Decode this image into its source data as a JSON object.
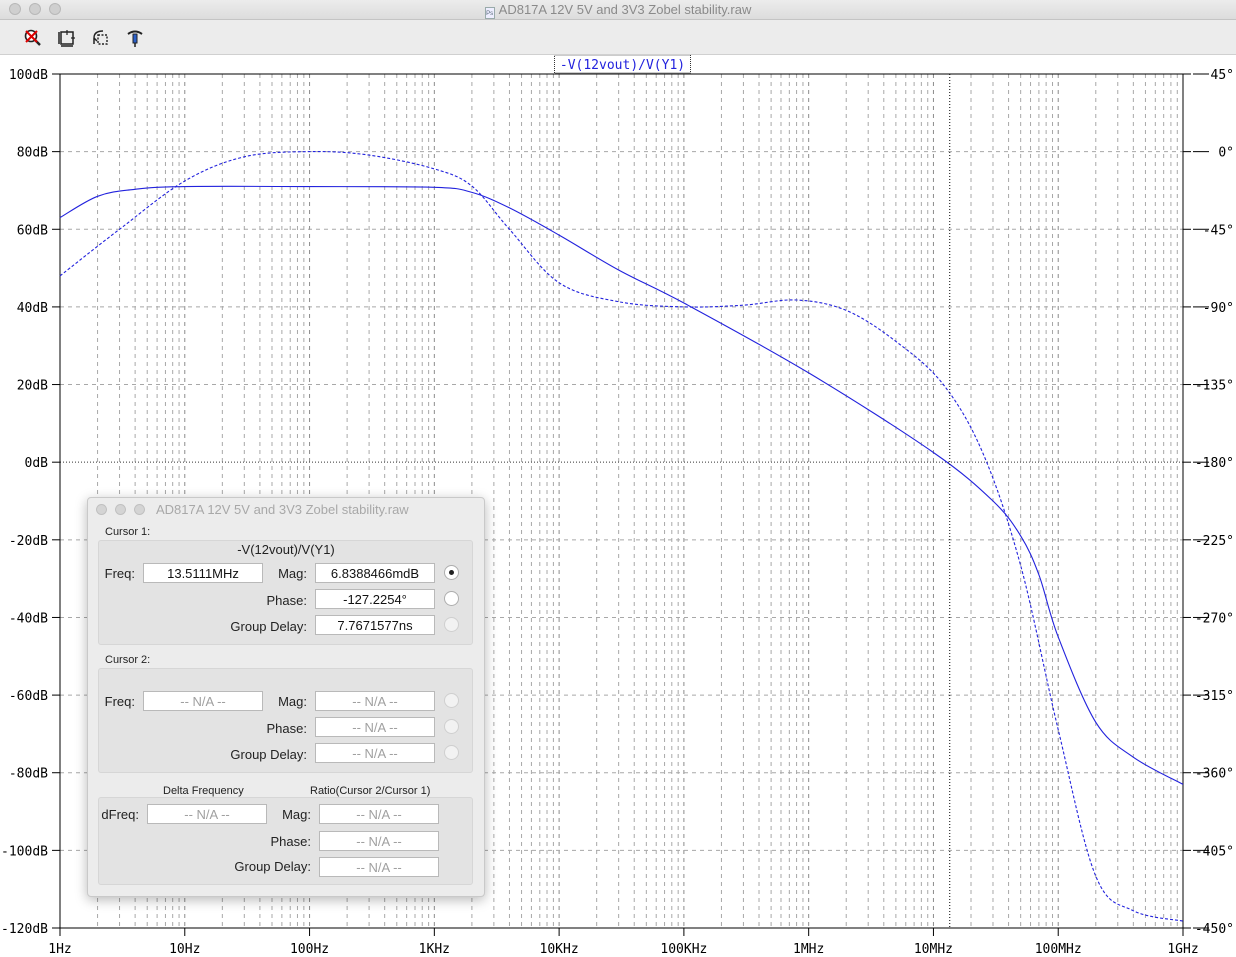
{
  "window": {
    "title": "AD817A 12V 5V and 3V3 Zobel stability.raw"
  },
  "toolbar": {
    "icons": [
      "zoom-cancel-icon",
      "autorange-icon",
      "undo-zoom-icon",
      "probe-icon"
    ]
  },
  "chart_data": {
    "type": "line",
    "trace_label": "-V(12vout)/V(Y1)",
    "x_scale": "log",
    "x_range_hz": [
      1,
      1000000000
    ],
    "x_tick_labels": [
      "1Hz",
      "10Hz",
      "100Hz",
      "1KHz",
      "10KHz",
      "100KHz",
      "1MHz",
      "10MHz",
      "100MHz",
      "1GHz"
    ],
    "y_left_range_db": [
      -120,
      100
    ],
    "y_left_tick_labels": [
      "100dB",
      "80dB",
      "60dB",
      "40dB",
      "20dB",
      "0dB",
      "-20dB",
      "-40dB",
      "-60dB",
      "-80dB",
      "-100dB",
      "-120dB"
    ],
    "y_right_range_deg": [
      -450,
      45
    ],
    "y_right_tick_labels": [
      "45°",
      "0°",
      "-45°",
      "-90°",
      "-135°",
      "-180°",
      "-225°",
      "-270°",
      "-315°",
      "-360°",
      "-405°",
      "-450°"
    ],
    "grid": "dashed gray, log decades",
    "cursor_frequency_hz": 13511100,
    "series": [
      {
        "style": "solid",
        "axis": "left",
        "color": "#2222dd",
        "points": [
          [
            1,
            63
          ],
          [
            2,
            68.5
          ],
          [
            4,
            70.3
          ],
          [
            10,
            71
          ],
          [
            100,
            71
          ],
          [
            1000,
            70.8
          ],
          [
            2000,
            69.5
          ],
          [
            4000,
            65.5
          ],
          [
            10000,
            58.5
          ],
          [
            30000,
            49.5
          ],
          [
            100000,
            41
          ],
          [
            1000000,
            23
          ],
          [
            10000000,
            2.5
          ],
          [
            30000000,
            -10
          ],
          [
            50000000,
            -19
          ],
          [
            70000000,
            -29
          ],
          [
            100000000,
            -45
          ],
          [
            200000000,
            -67
          ],
          [
            400000000,
            -76
          ],
          [
            1000000000,
            -83
          ]
        ]
      },
      {
        "style": "dashed",
        "axis": "right",
        "color": "#2222dd",
        "points": [
          [
            1,
            -72
          ],
          [
            3,
            -45
          ],
          [
            10,
            -17
          ],
          [
            30,
            -3
          ],
          [
            100,
            0
          ],
          [
            300,
            -2
          ],
          [
            1000,
            -10
          ],
          [
            2000,
            -20
          ],
          [
            4000,
            -45
          ],
          [
            10000,
            -76
          ],
          [
            30000,
            -87
          ],
          [
            100000,
            -90
          ],
          [
            300000,
            -89
          ],
          [
            800000,
            -86
          ],
          [
            2000000,
            -92
          ],
          [
            5000000,
            -110
          ],
          [
            12000000,
            -135
          ],
          [
            25000000,
            -175
          ],
          [
            50000000,
            -240
          ],
          [
            100000000,
            -335
          ],
          [
            200000000,
            -420
          ],
          [
            400000000,
            -440
          ],
          [
            1000000000,
            -446
          ]
        ]
      }
    ]
  },
  "cursor_panel": {
    "title": "AD817A 12V 5V and 3V3 Zobel stability.raw",
    "cursor1": {
      "label": "Cursor 1:",
      "trace": "-V(12vout)/V(Y1)",
      "freq_label": "Freq:",
      "freq": "13.5111MHz",
      "mag_label": "Mag:",
      "mag": "6.8388466mdB",
      "phase_label": "Phase:",
      "phase": "-127.2254°",
      "gd_label": "Group Delay:",
      "group_delay": "7.7671577ns"
    },
    "cursor2": {
      "label": "Cursor 2:",
      "freq_label": "Freq:",
      "freq": "-- N/A --",
      "mag_label": "Mag:",
      "mag": "-- N/A --",
      "phase_label": "Phase:",
      "phase": "-- N/A --",
      "gd_label": "Group Delay:",
      "group_delay": "-- N/A --"
    },
    "delta": {
      "delta_header": "Delta Frequency",
      "ratio_header": "Ratio(Cursor 2/Cursor 1)",
      "dfreq_label": "dFreq:",
      "dfreq": "-- N/A --",
      "mag_label": "Mag:",
      "mag": "-- N/A --",
      "phase_label": "Phase:",
      "phase": "-- N/A --",
      "gd_label": "Group Delay:",
      "group_delay": "-- N/A --"
    }
  }
}
